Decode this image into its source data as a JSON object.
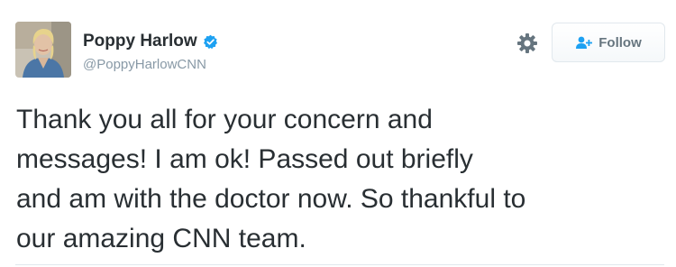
{
  "tweet": {
    "display_name": "Poppy Harlow",
    "handle": "@PoppyHarlowCNN",
    "verified": true,
    "follow_label": "Follow",
    "text_lines": [
      "Thank you all for your concern and",
      "messages!  I am ok!  Passed out briefly",
      "and am with the doctor now.  So thankful to",
      "our amazing CNN team."
    ]
  },
  "icons": {
    "verified": "verified-badge-icon",
    "settings": "gear-icon",
    "follow": "add-user-icon"
  },
  "colors": {
    "verified_blue": "#1da1f2",
    "text": "#292f33",
    "muted": "#8899a6",
    "follow_icon": "#1da1f2"
  }
}
